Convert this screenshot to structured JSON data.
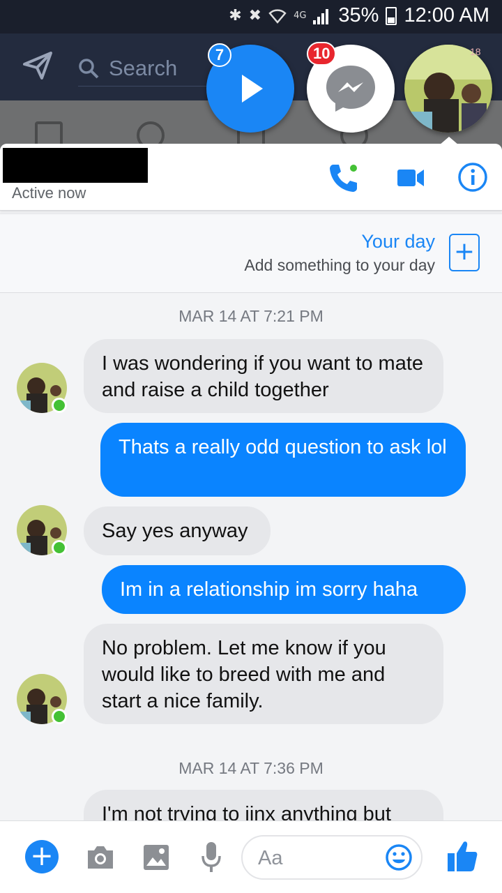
{
  "status_bar": {
    "network": "4G",
    "battery": "35%",
    "battery_level": 0.35,
    "time": "12:00 AM"
  },
  "top_bar": {
    "search_placeholder": "Search"
  },
  "chat_heads": [
    {
      "type": "video",
      "badge": "7"
    },
    {
      "type": "messenger",
      "badge": "10"
    },
    {
      "type": "user-avatar",
      "badge": "18"
    }
  ],
  "conversation": {
    "status": "Active now",
    "actions": [
      "phone-icon",
      "video-icon",
      "info-icon"
    ]
  },
  "your_day": {
    "title": "Your day",
    "subtitle": "Add something to your day",
    "add_label": "+"
  },
  "messages": [
    {
      "kind": "timestamp",
      "text": "MAR 14 AT 7:21 PM"
    },
    {
      "kind": "incoming",
      "text": "I was wondering if you want to mate and raise a child together"
    },
    {
      "kind": "outgoing",
      "text": "Thats a really odd question to ask lol"
    },
    {
      "kind": "incoming",
      "text": "Say yes anyway"
    },
    {
      "kind": "outgoing",
      "text": "Im in a relationship im sorry haha"
    },
    {
      "kind": "incoming",
      "text": "No problem. Let me know if you would like to breed with me and start a nice family."
    },
    {
      "kind": "timestamp",
      "text": "MAR 14 AT 7:36 PM"
    },
    {
      "kind": "incoming",
      "text": "I'm not trying to jinx anything but"
    }
  ],
  "composer": {
    "placeholder": "Aa",
    "plus_label": "+"
  },
  "colors": {
    "accent": "#0a84ff",
    "incoming_bubble": "#e6e7ea",
    "online": "#44c135",
    "badge_red": "#e8262e"
  }
}
